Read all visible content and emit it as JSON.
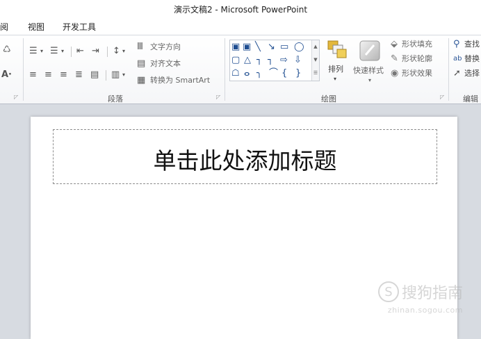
{
  "window": {
    "title": "演示文稿2 - Microsoft PowerPoint"
  },
  "tabs": [
    {
      "label": "阅"
    },
    {
      "label": "视图"
    },
    {
      "label": "开发工具"
    }
  ],
  "ribbon": {
    "paragraph": {
      "group_label": "段落",
      "text_direction_label": "文字方向",
      "align_text_label": "对齐文本",
      "smartart_label": "转换为 SmartArt"
    },
    "drawing": {
      "group_label": "绘图",
      "arrange_label": "排列",
      "quick_styles_label": "快速样式",
      "shape_fill_label": "形状填充",
      "shape_outline_label": "形状轮廓",
      "shape_effects_label": "形状效果"
    },
    "editing": {
      "group_label": "编辑",
      "find_label": "查找",
      "replace_label": "替换",
      "select_label": "选择"
    }
  },
  "slide": {
    "title_placeholder": "单击此处添加标题"
  },
  "watermark": {
    "name": "搜狗指南",
    "url": "zhinan.sogou.com"
  },
  "colors": {
    "ribbon_bg": "#f5f6f8",
    "workspace_bg": "#d7dbe1",
    "shape_icon": "#1e4d90"
  }
}
